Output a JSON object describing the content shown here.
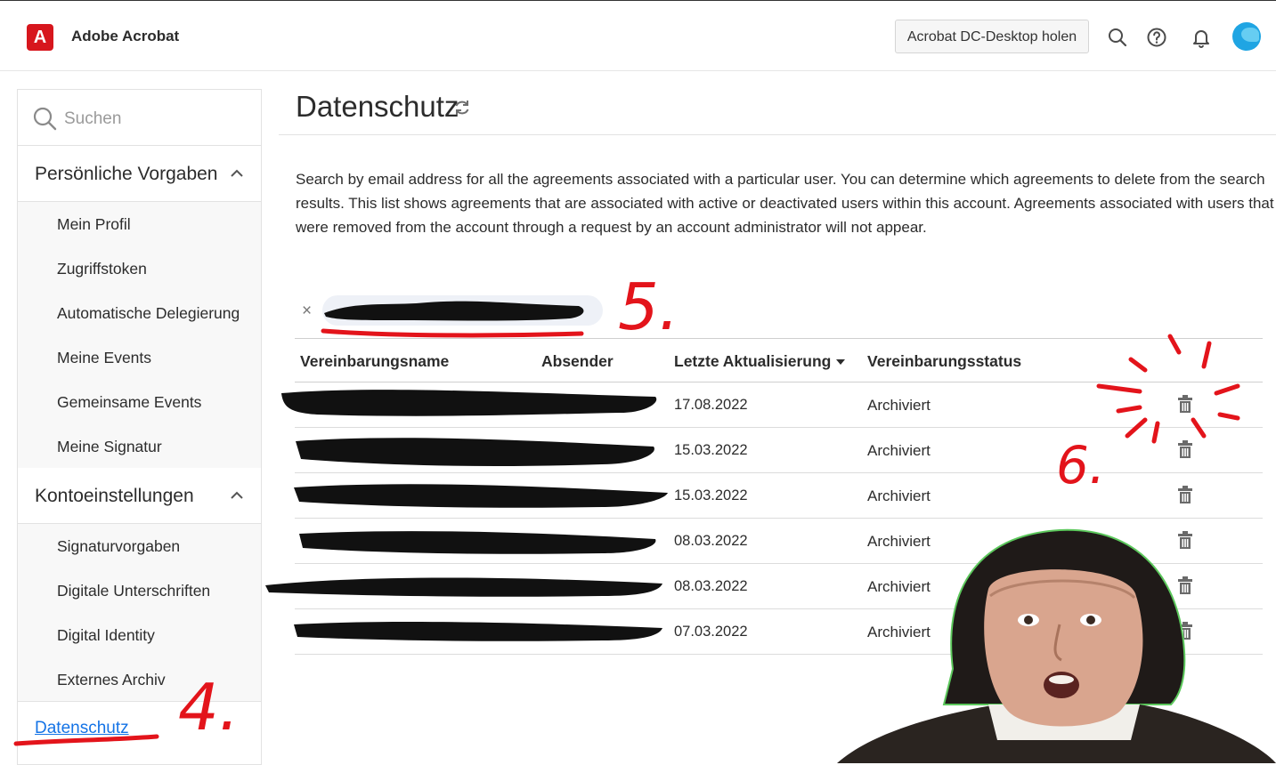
{
  "app": {
    "logo_glyph": "A",
    "title": "Adobe Acrobat",
    "accent": "#d7161d"
  },
  "header": {
    "desktop_button": "Acrobat DC-Desktop holen"
  },
  "sidebar": {
    "search_placeholder": "Suchen",
    "sections": [
      {
        "label": "Persönliche Vorgaben",
        "items": [
          "Mein Profil",
          "Zugriffstoken",
          "Automatische Delegierung",
          "Meine Events",
          "Gemeinsame Events",
          "Meine Signatur"
        ]
      },
      {
        "label": "Kontoeinstellungen",
        "items": [
          "Signaturvorgaben",
          "Digitale Unterschriften",
          "Digital Identity",
          "Externes Archiv"
        ]
      }
    ],
    "active_item": "Datenschutz",
    "link_color": "#1473e6"
  },
  "main": {
    "title": "Datenschutz",
    "description": "Search by email address for all the agreements associated with a particular user. You can determine which agreements to delete from the search results. This list shows agreements that are associated with active or deactivated users within this account. Agreements associated with users that were removed from the account through a request by an account administrator will not appear.",
    "filter_clear": "×"
  },
  "table": {
    "columns": [
      "Vereinbarungsname",
      "Absender",
      "Letzte Aktualisierung",
      "Vereinbarungsstatus"
    ],
    "rows": [
      {
        "updated": "17.08.2022",
        "status": "Archiviert"
      },
      {
        "updated": "15.03.2022",
        "status": "Archiviert"
      },
      {
        "updated": "15.03.2022",
        "status": "Archiviert"
      },
      {
        "updated": "08.03.2022",
        "status": "Archiviert"
      },
      {
        "updated": "08.03.2022",
        "status": "Archiviert"
      },
      {
        "updated": "07.03.2022",
        "status": "Archiviert"
      }
    ]
  },
  "annotations": {
    "step_4": "4.",
    "step_5": "5.",
    "step_6": "6.",
    "color": "#e3141b"
  }
}
